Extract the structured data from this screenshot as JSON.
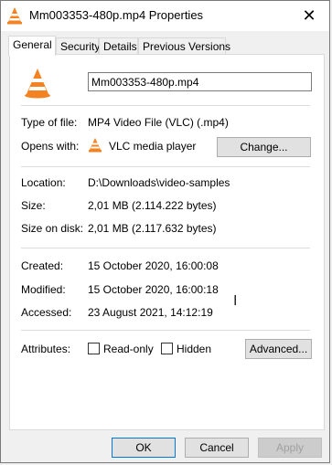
{
  "window": {
    "title": "Mm003353-480p.mp4 Properties",
    "close_glyph": "✕"
  },
  "tabs": [
    {
      "label": "General",
      "active": true
    },
    {
      "label": "Security"
    },
    {
      "label": "Details"
    },
    {
      "label": "Previous Versions"
    }
  ],
  "general": {
    "file_name": "Mm003353-480p.mp4",
    "type_label": "Type of file:",
    "type_value": "MP4 Video File (VLC) (.mp4)",
    "opens_label": "Opens with:",
    "opens_value": "VLC media player",
    "change_button": "Change...",
    "location_label": "Location:",
    "location_value": "D:\\Downloads\\video-samples",
    "size_label": "Size:",
    "size_value": "2,01 MB (2.114.222 bytes)",
    "size_on_disk_label": "Size on disk:",
    "size_on_disk_value": "2,01 MB (2.117.632 bytes)",
    "created_label": "Created:",
    "created_value": "15 October 2020, 16:00:08",
    "modified_label": "Modified:",
    "modified_value": "15 October 2020, 16:00:18",
    "accessed_label": "Accessed:",
    "accessed_value": "23 August 2021, 14:12:19",
    "attributes_label": "Attributes:",
    "readonly_label": "Read-only",
    "hidden_label": "Hidden",
    "advanced_button": "Advanced..."
  },
  "footer": {
    "ok": "OK",
    "cancel": "Cancel",
    "apply": "Apply"
  },
  "colors": {
    "vlc_orange": "#f58220",
    "accent": "#0078d7"
  },
  "icons": [
    "vlc-cone-icon",
    "close-icon",
    "text-cursor-icon"
  ]
}
